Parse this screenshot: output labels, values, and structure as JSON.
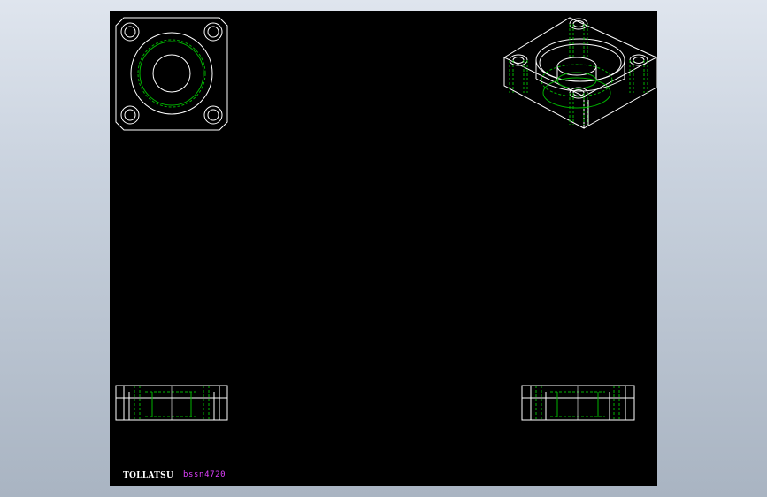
{
  "colors": {
    "background_top": "#dfe5ee",
    "background_bottom": "#a9b4c2",
    "sheet": "#000000",
    "outline": "#ffffff",
    "hidden_line": "#00b400",
    "logo_text": "#ffffff",
    "model_text": "#e040ff"
  },
  "views": [
    {
      "name": "top-view"
    },
    {
      "name": "isometric-view"
    },
    {
      "name": "front-view"
    },
    {
      "name": "side-view"
    }
  ],
  "title_block": {
    "logo": "TOLLATSU",
    "model": "bssn4720"
  }
}
